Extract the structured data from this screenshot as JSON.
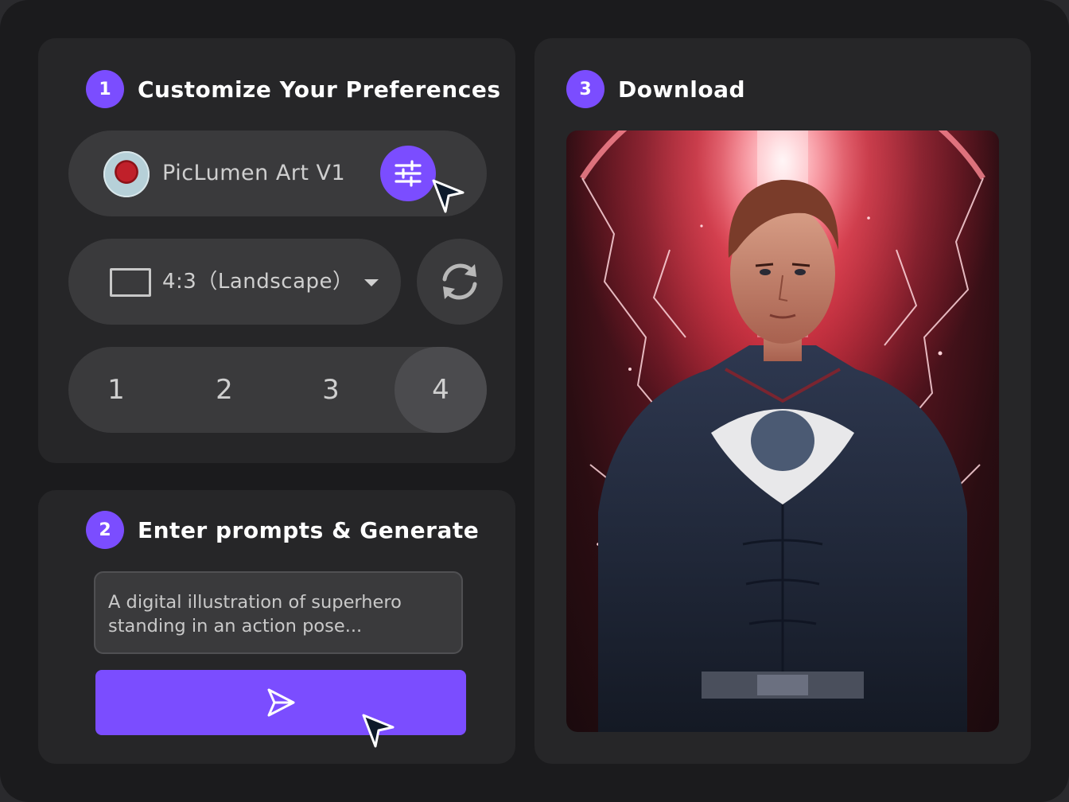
{
  "steps": [
    {
      "number": "1",
      "title": "Customize Your Preferences"
    },
    {
      "number": "2",
      "title": "Enter prompts & Generate"
    },
    {
      "number": "3",
      "title": "Download"
    }
  ],
  "model": {
    "name": "PicLumen Art V1",
    "avatar_icon": "rose-icon",
    "settings_icon": "sliders-icon"
  },
  "aspect": {
    "label": "4:3（Landscape）",
    "icon": "rectangle-icon",
    "dropdown_icon": "caret-down-icon"
  },
  "refresh_icon": "refresh-icon",
  "count_options": [
    "1",
    "2",
    "3",
    "4"
  ],
  "count_selected": "4",
  "prompt": {
    "value": "A digital illustration of superhero standing in an action pose..."
  },
  "generate": {
    "icon": "send-icon"
  },
  "colors": {
    "accent": "#7b4dff",
    "background": "#1b1b1d",
    "card": "#262628",
    "pill": "#3a3a3c"
  }
}
